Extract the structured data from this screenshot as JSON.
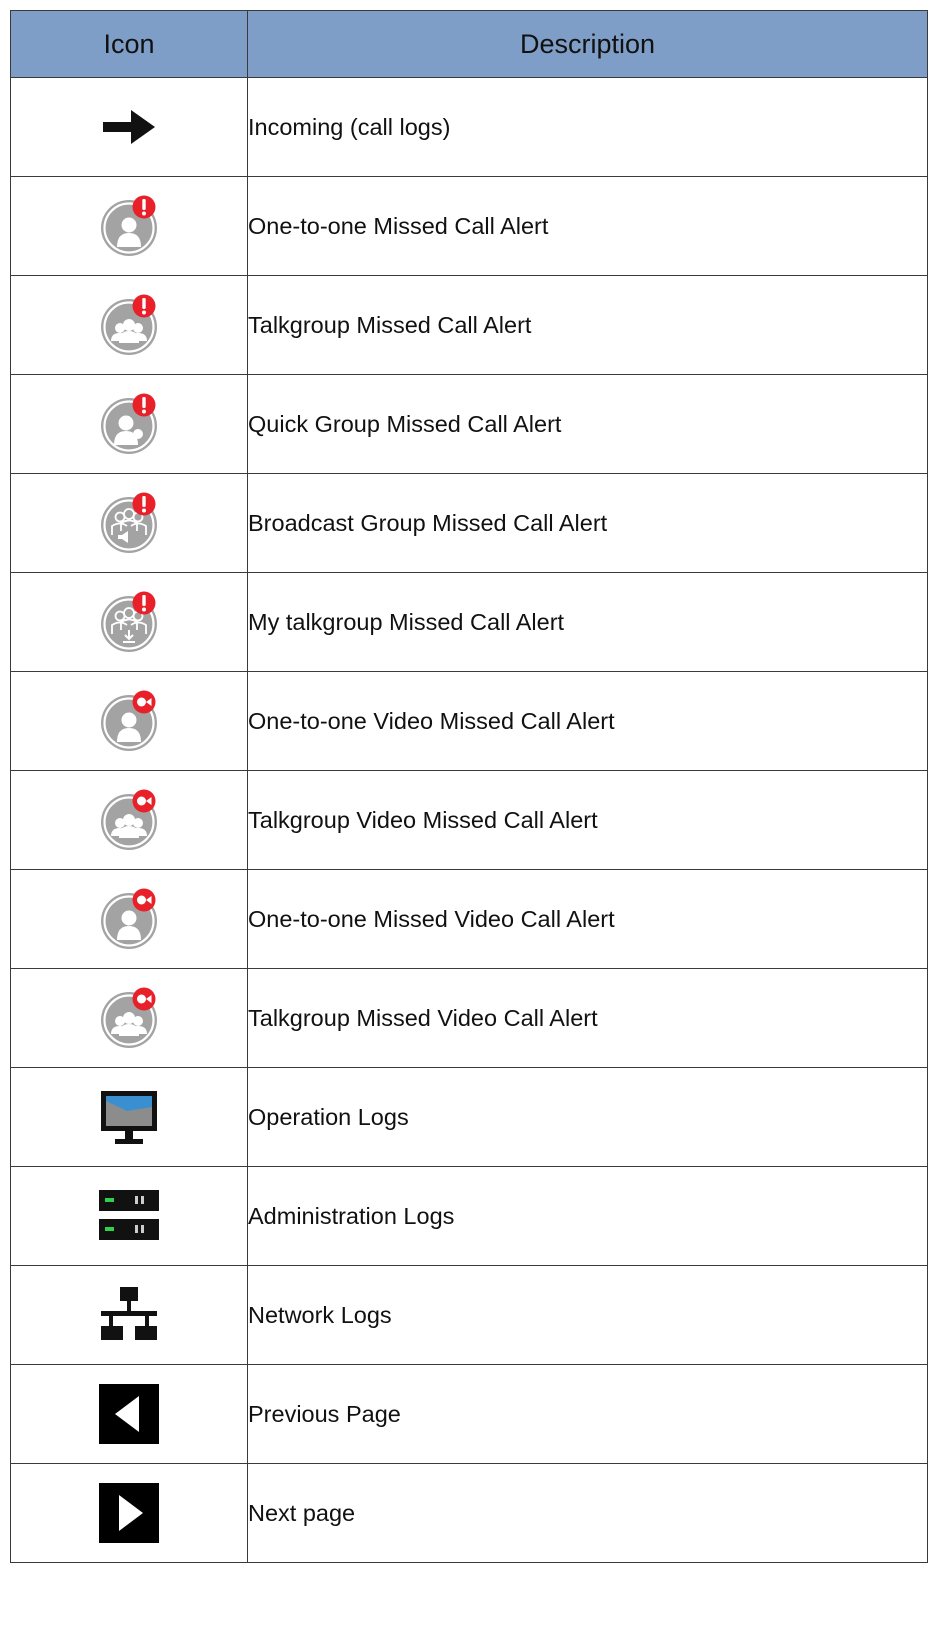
{
  "table": {
    "headers": {
      "icon": "Icon",
      "description": "Description"
    },
    "rows": [
      {
        "icon": "arrow-right-icon",
        "description": "Incoming (call logs)"
      },
      {
        "icon": "person-missed-alert-icon",
        "description": "One-to-one Missed Call Alert"
      },
      {
        "icon": "group-missed-alert-icon",
        "description": "Talkgroup Missed Call Alert"
      },
      {
        "icon": "quick-group-missed-alert-icon",
        "description": "Quick Group Missed Call Alert"
      },
      {
        "icon": "broadcast-group-missed-alert-icon",
        "description": "Broadcast Group Missed Call Alert"
      },
      {
        "icon": "my-talkgroup-missed-alert-icon",
        "description": "My talkgroup Missed Call Alert"
      },
      {
        "icon": "person-video-missed-alert-icon",
        "description": "One-to-one Video Missed Call Alert"
      },
      {
        "icon": "group-video-missed-alert-icon",
        "description": "Talkgroup Video Missed Call Alert"
      },
      {
        "icon": "person-video-missed-alert-icon",
        "description": "One-to-one Missed Video Call Alert"
      },
      {
        "icon": "group-video-missed-alert-icon",
        "description": "Talkgroup Missed Video Call Alert"
      },
      {
        "icon": "monitor-icon",
        "description": "Operation Logs"
      },
      {
        "icon": "server-icon",
        "description": "Administration Logs"
      },
      {
        "icon": "network-icon",
        "description": "Network Logs"
      },
      {
        "icon": "previous-page-icon",
        "description": "Previous Page"
      },
      {
        "icon": "next-page-icon",
        "description": "Next page"
      }
    ]
  },
  "colors": {
    "header_bg": "#7f9ec7",
    "alert_red": "#e8202a",
    "icon_gray": "#a3a3a3",
    "screen_blue": "#3a8fd0",
    "led_green": "#2ed14a"
  }
}
